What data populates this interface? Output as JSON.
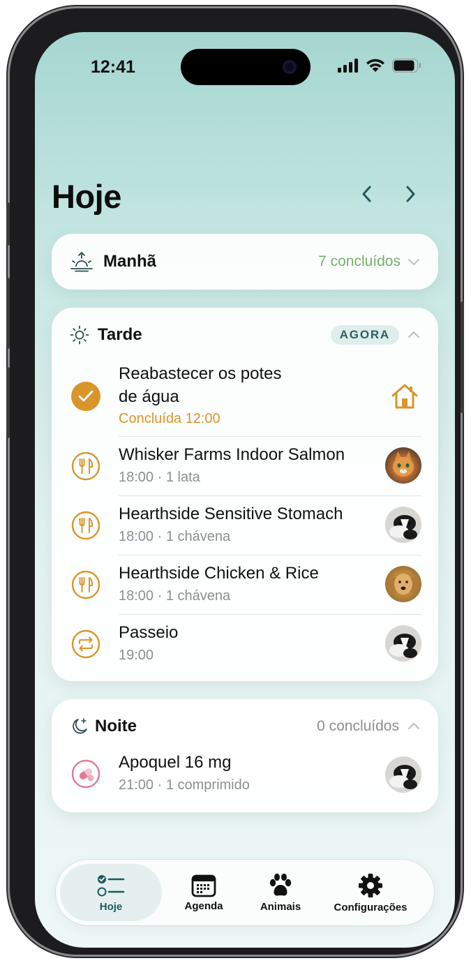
{
  "status_bar": {
    "time": "12:41"
  },
  "header": {
    "title": "Hoje"
  },
  "colors": {
    "accent": "#d9952a",
    "teal": "#2d5f5e",
    "green_text": "#76b06a",
    "pink": "#e07a95"
  },
  "sections": {
    "morning": {
      "title": "Manhã",
      "count": "7 concluídos",
      "icon": "sunrise-icon",
      "expanded": false
    },
    "afternoon": {
      "title": "Tarde",
      "badge": "AGORA",
      "icon": "sun-icon",
      "expanded": true,
      "items": [
        {
          "name_line1": "Reabastecer os potes",
          "name_line2": "de água",
          "detail": "Concluída 12:00",
          "status": "done",
          "icon": "check-circle-icon",
          "trailing": "house-icon"
        },
        {
          "name": "Whisker Farms Indoor Salmon",
          "detail": "18:00 · 1 lata",
          "icon": "fork-knife-icon",
          "pet": "orange-cat"
        },
        {
          "name": "Hearthside Sensitive Stomach",
          "detail": "18:00 · 1 chávena",
          "icon": "fork-knife-icon",
          "pet": "border-collie"
        },
        {
          "name": "Hearthside Chicken & Rice",
          "detail": "18:00 · 1 chávena",
          "icon": "fork-knife-icon",
          "pet": "golden-retriever"
        },
        {
          "name": "Passeio",
          "detail": "19:00",
          "icon": "repeat-icon",
          "pet": "border-collie"
        }
      ]
    },
    "night": {
      "title": "Noite",
      "count": "0 concluídos",
      "icon": "moon-stars-icon",
      "expanded": true,
      "items": [
        {
          "name": "Apoquel 16 mg",
          "detail": "21:00 · 1 comprimido",
          "icon": "pill-icon",
          "pet": "border-collie"
        }
      ]
    }
  },
  "tabbar": {
    "tabs": [
      {
        "label": "Hoje",
        "icon": "checklist-icon",
        "active": true
      },
      {
        "label": "Agenda",
        "icon": "calendar-icon",
        "active": false
      },
      {
        "label": "Animais",
        "icon": "paw-icon",
        "active": false
      },
      {
        "label": "Configurações",
        "icon": "gear-icon",
        "active": false
      }
    ]
  }
}
